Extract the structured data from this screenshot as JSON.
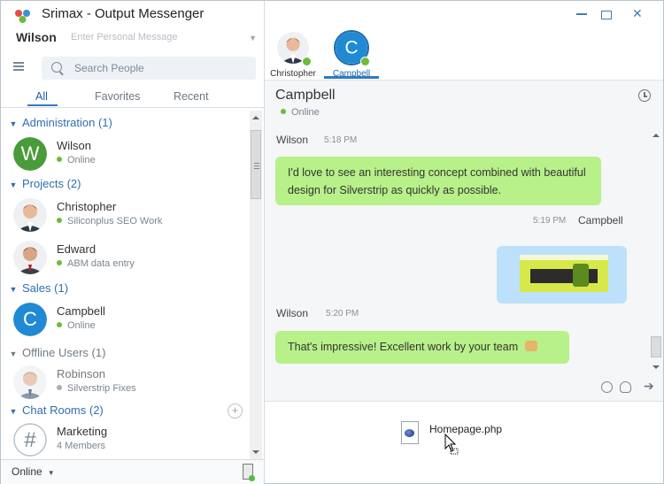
{
  "app": {
    "title": "Srimax - Output Messenger",
    "user_name": "Wilson",
    "personal_message_placeholder": "Enter Personal Message",
    "window_controls": {
      "minimize": "▭",
      "maximize": "▣",
      "close": "✕"
    }
  },
  "sidebar": {
    "search_placeholder": "Search People",
    "tabs": [
      {
        "label": "All",
        "active": true
      },
      {
        "label": "Favorites",
        "active": false
      },
      {
        "label": "Recent",
        "active": false
      }
    ],
    "groups": [
      {
        "label": "Administration (1)"
      },
      {
        "label": "Projects (2)"
      },
      {
        "label": "Sales (1)"
      },
      {
        "label": "Offline Users (1)"
      },
      {
        "label": "Chat Rooms (2)"
      }
    ],
    "contacts": [
      {
        "name": "Wilson",
        "status": "Online",
        "initial": "W",
        "avatar_color": "#4a9b3a"
      },
      {
        "name": "Christopher",
        "status": "Siliconplus SEO Work"
      },
      {
        "name": "Edward",
        "status": "ABM data entry"
      },
      {
        "name": "Campbell",
        "status": "Online",
        "initial": "C",
        "avatar_color": "#1f8ad3"
      },
      {
        "name": "Robinson",
        "status": "Silverstrip Fixes"
      },
      {
        "name": "Marketing",
        "status": "4 Members",
        "initial": "#"
      }
    ],
    "presence": "Online"
  },
  "chat_tabs": [
    {
      "label": "Christopher",
      "active": false
    },
    {
      "label": "Campbell",
      "active": true,
      "initial": "C"
    }
  ],
  "chat": {
    "contact_name": "Campbell",
    "contact_status": "Online",
    "messages": [
      {
        "sender": "Wilson",
        "time": "5:18 PM",
        "text": "I'd love to see an interesting concept combined with beautiful design for Silverstrip as quickly as possible."
      },
      {
        "sender": "Campbell",
        "time": "5:19 PM",
        "text": ""
      },
      {
        "sender": "Wilson",
        "time": "5:20 PM",
        "text": "That's impressive! Excellent work by your team"
      }
    ],
    "attachment": {
      "file_name": "Homepage.php"
    }
  },
  "colors": {
    "accent": "#2f79c8",
    "online": "#6dbb3a",
    "bubble_green": "#b8f089",
    "bubble_blue": "#bde0fb"
  }
}
